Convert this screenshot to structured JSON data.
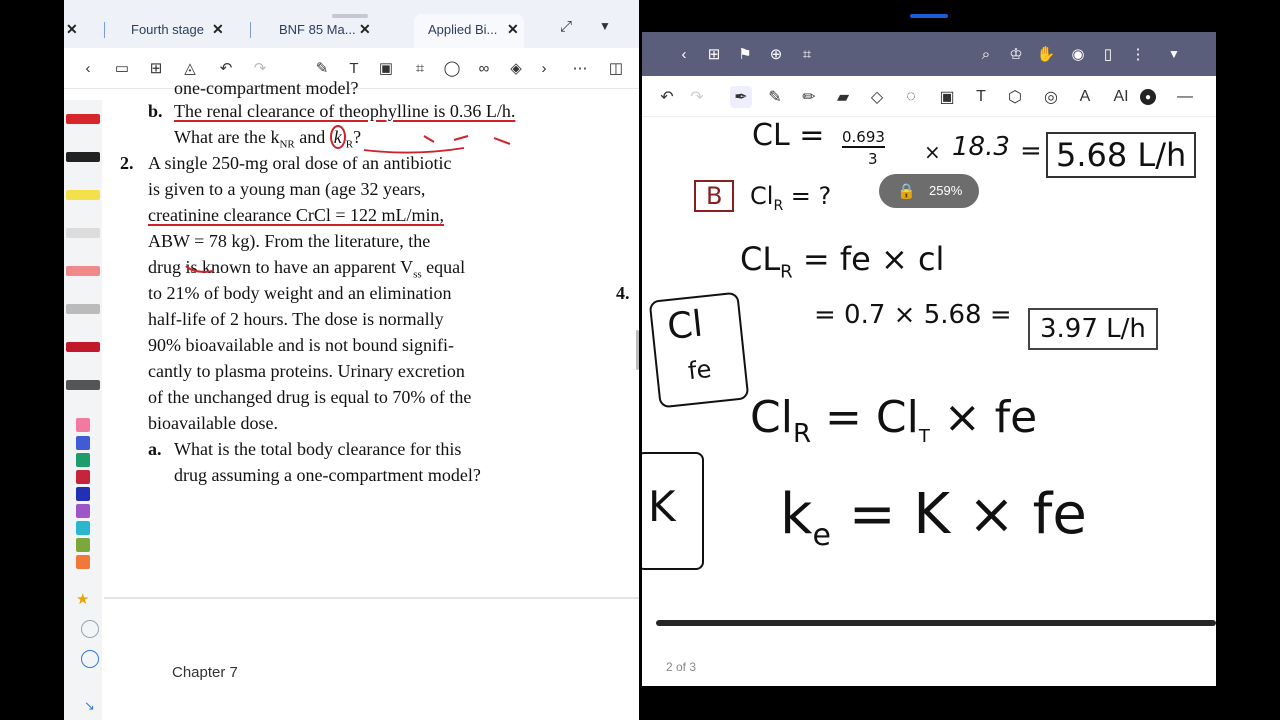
{
  "left": {
    "tabs": [
      {
        "label": "Fourth stage"
      },
      {
        "label": "BNF 85 Ma..."
      },
      {
        "label": "Applied Bi..."
      }
    ],
    "book": {
      "line0": "one-compartment model?",
      "b_label": "b.",
      "b_line1": "The renal clearance of theophylline is 0.36 L/h.",
      "b_line2_a": "What are the k",
      "b_line2_sub1": "NR",
      "b_line2_b": " and ",
      "b_line2_k": "k",
      "b_line2_sub2": "R",
      "b_line2_c": "?",
      "q2_num": "2.",
      "q2_lines": [
        "A single 250-mg oral dose of an antibiotic",
        "is given to a young man (age 32 years,",
        "creatinine clearance CrCl = 122 mL/min,",
        "ABW = 78 kg). From the literature, the",
        "drug is known to have an apparent V",
        "to 21% of body weight and an elimination",
        "half-life of 2 hours. The dose is normally",
        "90% bioavailable and is not bound signifi-",
        "cantly to plasma proteins. Urinary excretion",
        "of the unchanged drug is equal to 70% of the",
        "bioavailable dose."
      ],
      "vd_sub": "ss",
      "vd_tail": " equal",
      "a_label": "a.",
      "a_line1": "What is the total body clearance for this",
      "a_line2": "drug assuming a one-compartment model?",
      "side_number": "4."
    },
    "chapter": "Chapter 7"
  },
  "right": {
    "zoom": "259%",
    "page_indicator": "2 of 3",
    "notes": {
      "cl_lhs": "CL =",
      "cl_frac_num": "0.693",
      "cl_frac_den": "3",
      "cl_times": "×",
      "cl_vd": "18.3",
      "cl_eq": "=",
      "cl_result": "5.68 L/h",
      "q_b": "B",
      "clr_q": "Cl",
      "clr_sub": "R",
      "clr_tail": " = ?",
      "clr_formula": "CL",
      "clr_formula_sub": "R",
      "clr_formula_rhs": " = fe × cl",
      "calc": "= 0.7 × 5.68 =",
      "calc_result": "3.97 L/h",
      "box_cl": "Cl",
      "box_fe": "fe",
      "big_lhs": "Cl",
      "big_lhs_sub": "R",
      "big_rhs": " = Cl",
      "big_rhs_sub": "T",
      "big_tail": " × fe",
      "k_box": "K",
      "ke_lhs": "k",
      "ke_sub": "e",
      "ke_rhs": " = K × fe"
    }
  }
}
